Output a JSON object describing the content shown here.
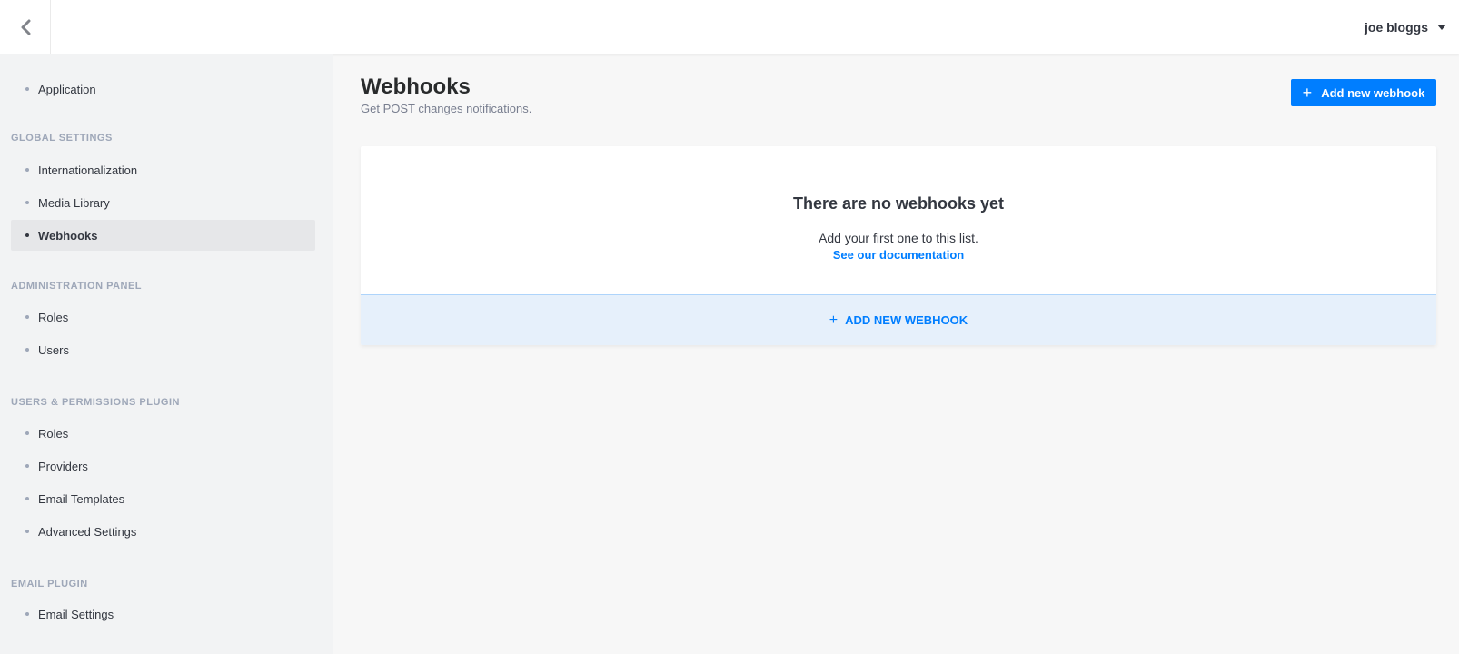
{
  "header": {
    "user_name": "joe bloggs"
  },
  "sidebar": {
    "top_items": [
      {
        "label": "Application"
      }
    ],
    "sections": [
      {
        "title": "GLOBAL SETTINGS",
        "items": [
          "Internationalization",
          "Media Library",
          "Webhooks"
        ]
      },
      {
        "title": "ADMINISTRATION PANEL",
        "items": [
          "Roles",
          "Users"
        ]
      },
      {
        "title": "USERS & PERMISSIONS PLUGIN",
        "items": [
          "Roles",
          "Providers",
          "Email Templates",
          "Advanced Settings"
        ]
      },
      {
        "title": "EMAIL PLUGIN",
        "items": [
          "Email Settings"
        ]
      }
    ],
    "active_item": "Webhooks"
  },
  "main": {
    "title": "Webhooks",
    "subtitle": "Get POST changes notifications.",
    "add_button_label": "Add new webhook",
    "empty_state": {
      "title": "There are no webhooks yet",
      "text": "Add your first one to this list.",
      "link": "See our documentation",
      "footer_button_label": "ADD NEW WEBHOOK"
    }
  },
  "colors": {
    "accent": "#007eff",
    "sidebar_bg": "#f2f3f4",
    "page_bg": "#f7f7f7"
  },
  "icons": {
    "back": "chevron-left-icon",
    "user_menu": "caret-down-icon",
    "add": "plus-icon"
  }
}
